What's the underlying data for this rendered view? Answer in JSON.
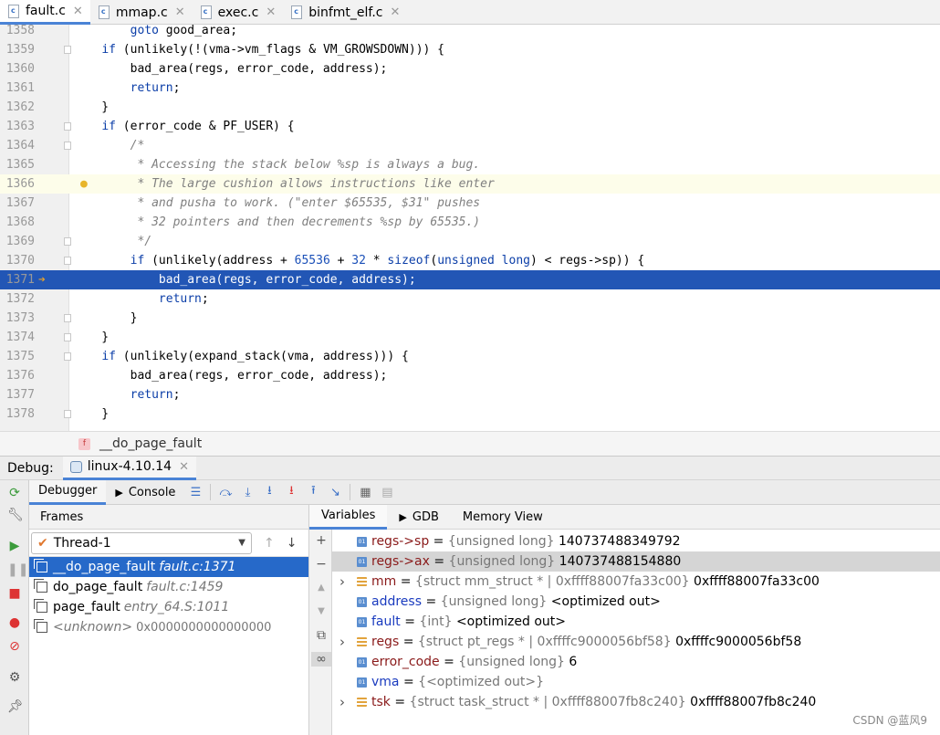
{
  "editor_tabs": [
    {
      "label": "fault.c",
      "active": true
    },
    {
      "label": "mmap.c",
      "active": false
    },
    {
      "label": "exec.c",
      "active": false
    },
    {
      "label": "binfmt_elf.c",
      "active": false
    }
  ],
  "code": {
    "lines": [
      {
        "num": "1358",
        "text": "        goto good_area;"
      },
      {
        "num": "1359",
        "text": "    if (unlikely(!(vma->vm_flags & VM_GROWSDOWN))) {"
      },
      {
        "num": "1360",
        "text": "        bad_area(regs, error_code, address);"
      },
      {
        "num": "1361",
        "text": "        return;"
      },
      {
        "num": "1362",
        "text": "    }"
      },
      {
        "num": "1363",
        "text": "    if (error_code & PF_USER) {"
      },
      {
        "num": "1364",
        "text": "        /*"
      },
      {
        "num": "1365",
        "text": "         * Accessing the stack below %sp is always a bug."
      },
      {
        "num": "1366",
        "text": "         * The large cushion allows instructions like enter"
      },
      {
        "num": "1367",
        "text": "         * and pusha to work. (\"enter $65535, $31\" pushes"
      },
      {
        "num": "1368",
        "text": "         * 32 pointers and then decrements %sp by 65535.)"
      },
      {
        "num": "1369",
        "text": "         */"
      },
      {
        "num": "1370",
        "text": "        if (unlikely(address + 65536 + 32 * sizeof(unsigned long) < regs->sp)) {"
      },
      {
        "num": "1371",
        "text": "            bad_area(regs, error_code, address);"
      },
      {
        "num": "1372",
        "text": "            return;"
      },
      {
        "num": "1373",
        "text": "        }"
      },
      {
        "num": "1374",
        "text": "    }"
      },
      {
        "num": "1375",
        "text": "    if (unlikely(expand_stack(vma, address))) {"
      },
      {
        "num": "1376",
        "text": "        bad_area(regs, error_code, address);"
      },
      {
        "num": "1377",
        "text": "        return;"
      },
      {
        "num": "1378",
        "text": "    }"
      }
    ]
  },
  "breadcrumb": {
    "badge": "f",
    "function": "__do_page_fault"
  },
  "debug": {
    "label": "Debug:",
    "run_config": "linux-4.10.14",
    "tabs": [
      "Debugger",
      "Console"
    ]
  },
  "frames": {
    "header": "Frames",
    "thread": "Thread-1",
    "items": [
      {
        "name": "__do_page_fault",
        "loc": "fault.c:1371"
      },
      {
        "name": "do_page_fault",
        "loc": "fault.c:1459"
      },
      {
        "name": "page_fault",
        "loc": "entry_64.S:1011"
      },
      {
        "name": "<unknown>",
        "loc": "0x0000000000000000"
      }
    ]
  },
  "variables": {
    "tabs": [
      "Variables",
      "GDB",
      "Memory View"
    ],
    "items": [
      {
        "name": "regs->sp",
        "eq": " = ",
        "type": "{unsigned long} ",
        "value": "140737488349792"
      },
      {
        "name": "regs->ax",
        "eq": " = ",
        "type": "{unsigned long} ",
        "value": "140737488154880"
      },
      {
        "name": "mm",
        "eq": " = ",
        "type": "{struct mm_struct * | 0xffff88007fa33c00} ",
        "value": "0xffff88007fa33c00"
      },
      {
        "name": "address",
        "eq": " = ",
        "type": "{unsigned long} ",
        "value": "<optimized out>"
      },
      {
        "name": "fault",
        "eq": " = ",
        "type": "{int} ",
        "value": "<optimized out>"
      },
      {
        "name": "regs",
        "eq": " = ",
        "type": "{struct pt_regs * | 0xffffc9000056bf58} ",
        "value": "0xffffc9000056bf58"
      },
      {
        "name": "error_code",
        "eq": " = ",
        "type": "{unsigned long} ",
        "value": "6"
      },
      {
        "name": "vma",
        "eq": " = ",
        "type": "{<optimized out>}",
        "value": ""
      },
      {
        "name": "tsk",
        "eq": " = ",
        "type": "{struct task_struct * | 0xffff88007fb8c240} ",
        "value": "0xffff88007fb8c240"
      }
    ]
  },
  "watermark": "CSDN @蓝风9",
  "colors": {
    "accent": "#4a83d6",
    "exec_line": "#2256b5",
    "selected_frame": "#2669c9"
  }
}
